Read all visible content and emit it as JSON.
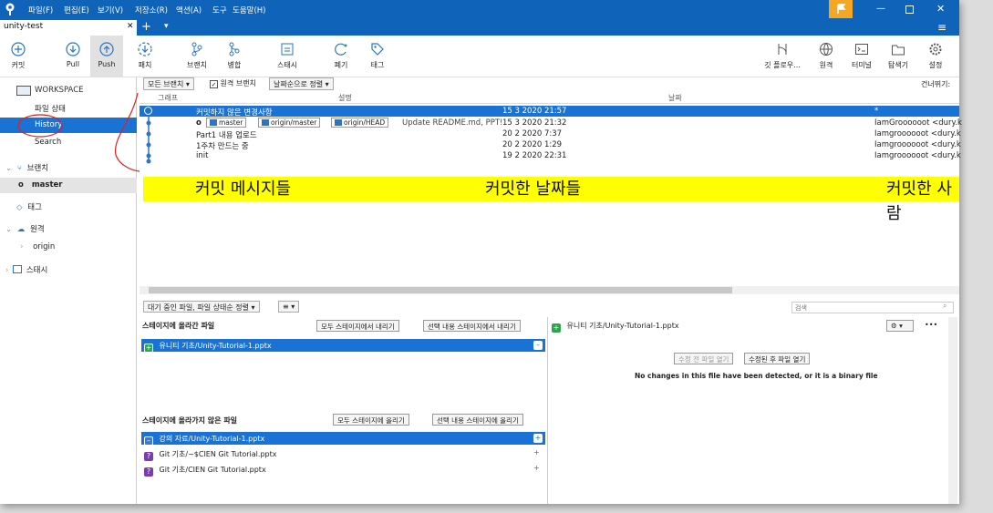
{
  "menubar": {
    "items": [
      "파일(F)",
      "편집(E)",
      "보기(V)",
      "저장소(R)",
      "액션(A)",
      "도구",
      "도움말(H)"
    ]
  },
  "tab": {
    "title": "unity-test",
    "close": "✕",
    "add": "+",
    "dropdown": "▾"
  },
  "toolbar": {
    "left": [
      {
        "icon": "plus-circle-icon",
        "label": "커밋"
      },
      {
        "icon": "arrow-down-circle-icon",
        "label": "Pull"
      },
      {
        "icon": "arrow-up-circle-icon",
        "label": "Push"
      },
      {
        "icon": "fetch-icon",
        "label": "패치"
      },
      {
        "icon": "branch-icon",
        "label": "브랜치"
      },
      {
        "icon": "merge-icon",
        "label": "병합"
      },
      {
        "icon": "stash-icon",
        "label": "스태시"
      },
      {
        "icon": "discard-icon",
        "label": "폐기"
      },
      {
        "icon": "tag-icon",
        "label": "태그"
      }
    ],
    "right": [
      {
        "icon": "git-flow-icon",
        "label": "깃 플로우..."
      },
      {
        "icon": "globe-icon",
        "label": "원격"
      },
      {
        "icon": "terminal-icon",
        "label": "터미널"
      },
      {
        "icon": "folder-icon",
        "label": "탐색기"
      },
      {
        "icon": "settings-icon",
        "label": "설정"
      }
    ]
  },
  "sidebar": {
    "workspace": "WORKSPACE",
    "file_status": "파일 상태",
    "history": "History",
    "search": "Search",
    "branches": "브랜치",
    "master": "master",
    "tags": "태그",
    "remotes": "원격",
    "origin": "origin",
    "stashes": "스태시"
  },
  "history_toolbar": {
    "branch_filter": "모든 브랜치 ▾",
    "remote_branch_check": "원격 브랜치",
    "sort": "날짜순으로 정렬 ▾",
    "jump": "건너뛰기:"
  },
  "columns": {
    "graph": "그래프",
    "description": "설명",
    "date": "날짜"
  },
  "commits": [
    {
      "desc": "커밋하지 않은 변경사항",
      "date": "15 3 2020 21:57",
      "author": "*",
      "selected": true
    },
    {
      "desc": "Update README.md, PPT!",
      "date": "15 3 2020 21:32",
      "author": "IamGroooooot <dury.k",
      "tags": [
        "master",
        "origin/master",
        "origin/HEAD"
      ]
    },
    {
      "desc": "Part1 내용 업로드",
      "date": "20 2 2020 7:37",
      "author": "Iamgroooooot <dury.k"
    },
    {
      "desc": "1주차 만드는 중",
      "date": "20 2 2020 1:29",
      "author": "Iamgroooooot <dury.k"
    },
    {
      "desc": "init",
      "date": "19 2 2020 22:31",
      "author": "Iamgroooooot <dury.k"
    }
  ],
  "annotations": [
    "커밋 메시지들",
    "커밋한 날짜들",
    "커밋한 사람"
  ],
  "bottom_toolbar": {
    "pending_sort": "대기 중인 파일, 파일 상태순 정렬 ▾",
    "list_view": "≡ ▾",
    "search_placeholder": "검색"
  },
  "staged": {
    "title": "스테이지에 올라간 파일",
    "unstage_all": "모두 스테이지에서 내리기",
    "unstage_selected": "선택 내용 스테이지에서 내리기",
    "files": [
      "유니티 기초/Unity-Tutorial-1.pptx"
    ]
  },
  "unstaged": {
    "title": "스테이지에 올라가지 않은 파일",
    "stage_all": "모두 스테이지에 올리기",
    "stage_selected": "선택 내용 스테이지에 올리기",
    "files": [
      "강의 자료/Unity-Tutorial-1.pptx",
      "Git 기초/~$CIEN Git Tutorial.pptx",
      "Git 기초/CIEN Git Tutorial.pptx"
    ]
  },
  "diff": {
    "file": "유니티 기초/Unity-Tutorial-1.pptx",
    "open_before": "수정 전 파일 열기",
    "open_after": "수정된 후 파일 열기",
    "message": "No changes in this file have been detected, or it is a binary file",
    "more": "•••"
  },
  "colors": {
    "accent": "#0f63b8",
    "selected": "#1a73d4",
    "annotation": "#ffff00",
    "staged_icon": "#2da44e",
    "deleted_icon": "#4477cc",
    "unknown_icon": "#7a3cb0"
  }
}
